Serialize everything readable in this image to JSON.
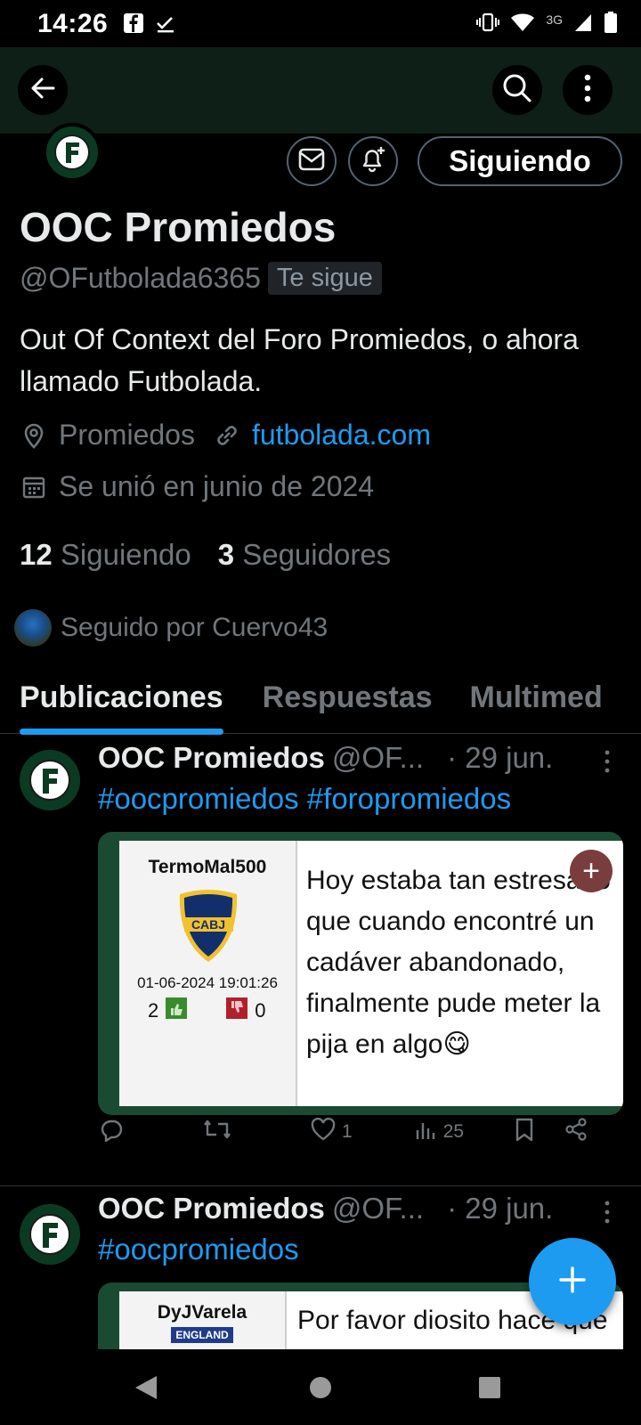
{
  "status_bar": {
    "time": "14:26",
    "network": "3G"
  },
  "profile": {
    "name": "OOC Promiedos",
    "handle": "@OFutbolada6365",
    "follows_you_badge": "Te sigue",
    "bio": "Out Of Context del Foro Promiedos, o ahora llamado Futbolada.",
    "location": "Promiedos",
    "website": "futbolada.com",
    "joined": "Se unió en junio de 2024",
    "following_count": "12",
    "following_label": "Siguiendo",
    "followers_count": "3",
    "followers_label": "Seguidores",
    "followed_by": "Seguido por Cuervo43",
    "follow_button": "Siguiendo"
  },
  "tabs": [
    {
      "label": "Publicaciones",
      "active": true
    },
    {
      "label": "Respuestas",
      "active": false
    },
    {
      "label": "Multimed",
      "active": false
    }
  ],
  "posts": [
    {
      "name": "OOC Promiedos",
      "handle": "@OF...",
      "date": "· 29 jun.",
      "tags": "#oocpromiedos #foropromiedos",
      "media": {
        "user": "TermoMal500",
        "crest": "CABJ",
        "datetime": "01-06-2024 19:01:26",
        "votes_up": "2",
        "votes_down": "0",
        "quote": "Hoy estaba tan estresado que cuando encontré un cadáver abandonado, finalmente pude meter la pija en algo😋"
      },
      "likes": "1",
      "views": "25"
    },
    {
      "name": "OOC Promiedos",
      "handle": "@OF...",
      "date": "· 29 jun.",
      "tags": "#oocpromiedos",
      "media": {
        "user": "DyJVarela",
        "crest": "ENGLAND",
        "quote": "Por favor diosito hace que pare de llevar mi"
      }
    }
  ],
  "colors": {
    "accent": "#1d9bf0",
    "header_bg": "#0d1f17",
    "muted": "#71767b"
  }
}
